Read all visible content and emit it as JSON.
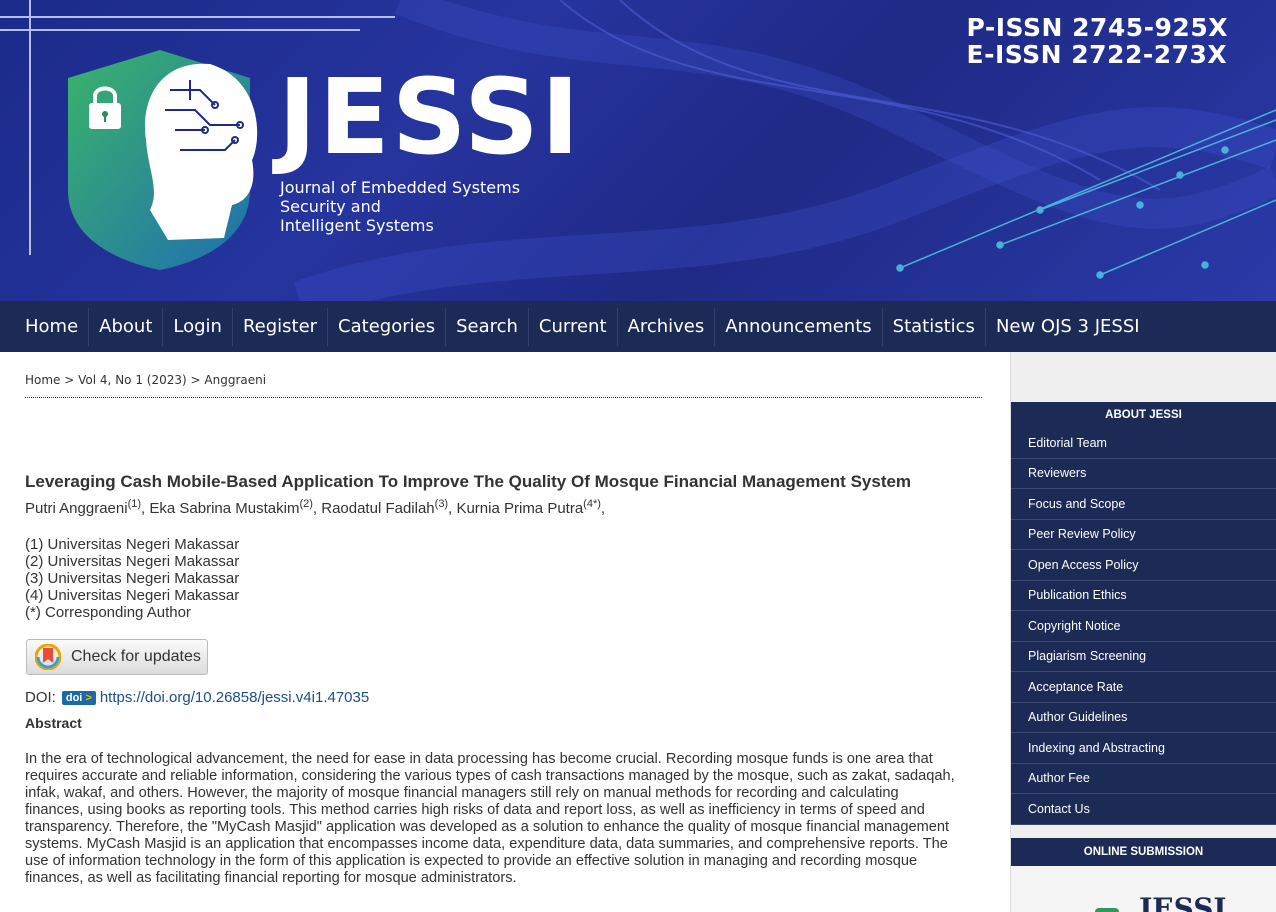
{
  "banner": {
    "issn_print": "P-ISSN 2745-925X",
    "issn_online": "E-ISSN 2722-273X",
    "journal_abbr": "JESSI",
    "journal_name_lines": [
      "Journal of Embedded Systems",
      "Security and",
      "Intelligent Systems"
    ],
    "logo_icon": "lock-shield-brain-icon"
  },
  "nav": {
    "items": [
      "Home",
      "About",
      "Login",
      "Register",
      "Categories",
      "Search",
      "Current",
      "Archives",
      "Announcements",
      "Statistics",
      "New OJS 3 JESSI"
    ]
  },
  "breadcrumb": {
    "home": "Home",
    "issue": "Vol 4, No 1 (2023)",
    "current": "Anggraeni",
    "separator": ">"
  },
  "article": {
    "title": "Leveraging Cash Mobile-Based Application To Improve The Quality Of Mosque Financial Management System",
    "authors": [
      {
        "name": "Putri Anggraeni",
        "sup": "(1)"
      },
      {
        "name": "Eka Sabrina Mustakim",
        "sup": "(2)"
      },
      {
        "name": "Raodatul Fadilah",
        "sup": "(3)"
      },
      {
        "name": "Kurnia Prima Putra",
        "sup": "(4*)"
      }
    ],
    "affiliations": [
      "(1) Universitas Negeri Makassar",
      "(2) Universitas Negeri Makassar",
      "(3) Universitas Negeri Makassar",
      "(4) Universitas Negeri Makassar",
      "(*) Corresponding Author"
    ],
    "check_updates_label": "Check for updates",
    "doi_label": "DOI:",
    "doi_badge": "doi",
    "doi_url": "https://doi.org/10.26858/jessi.v4i1.47035",
    "abstract_heading": "Abstract",
    "abstract_lines": [
      "In the era of technological advancement, the need for ease in data processing has become crucial. Recording mosque funds is one area that",
      "requires accurate and reliable information, considering the various types of cash transactions managed by the mosque, such as zakat, sadaqah,",
      "infak, wakaf, and others. However, the majority of mosque financial managers still rely on manual methods for recording and calculating",
      "finances, using books as reporting tools. This method carries high risks of data and report loss, as well as inefficiency in terms of speed and",
      "transparency. Therefore, the \"MyCash Masjid\" application was developed as a solution to enhance the quality of mosque financial management",
      "systems. MyCash Masjid is an application that encompasses income data, expenditure data, data summaries, and comprehensive reports. The",
      "use of information technology in the form of this application is expected to provide an effective solution in managing and recording mosque",
      "finances, as well as facilitating financial reporting for mosque administrators."
    ]
  },
  "sidebar": {
    "about_heading": "ABOUT JESSI",
    "about_items": [
      "Editorial Team",
      "Reviewers",
      "Focus and Scope",
      "Peer Review Policy",
      "Open Access Policy",
      "Publication Ethics",
      "Copyright Notice",
      "Plagiarism Screening",
      "Acceptance Rate",
      "Author Guidelines",
      "Indexing and Abstracting",
      "Author Fee",
      "Contact Us"
    ],
    "submission_heading": "ONLINE SUBMISSION",
    "logo_text": "JESSI"
  },
  "colors": {
    "banner_blue": "#26349e",
    "nav_navy": "#1c2a56",
    "shield_green": "#2f9a57",
    "link_blue": "#1c4e8a"
  }
}
